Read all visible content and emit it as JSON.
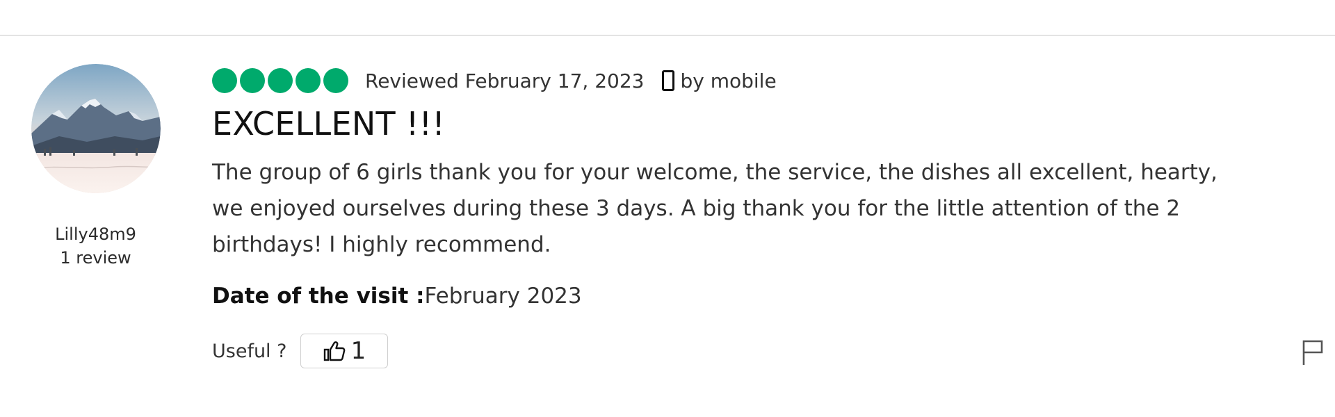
{
  "review": {
    "rating": {
      "value": 5,
      "max": 5,
      "color": "#00aa6c"
    },
    "date_text": "Reviewed February 17, 2023",
    "device_text": "by mobile",
    "title": "EXCELLENT !!!",
    "body": "The group of 6 girls thank you for your welcome, the service, the dishes all excellent, hearty, we enjoyed ourselves during these 3 days. A big thank you for the little attention of the 2 birthdays! I highly recommend.",
    "visit_label": "Date of the visit :",
    "visit_value": "February 2023",
    "useful_label": "Useful ?",
    "helpful_votes": "1"
  },
  "user": {
    "username": "Lilly48m9",
    "review_count": "1 review",
    "avatar": "mountain-landscape-avatar"
  },
  "icons": {
    "device": "mobile-phone-icon",
    "vote": "thumbs-up-icon",
    "report": "flag-icon"
  },
  "colors": {
    "rating_bubble": "#00aa6c",
    "divider": "#e3e3e3",
    "text": "#333333"
  }
}
